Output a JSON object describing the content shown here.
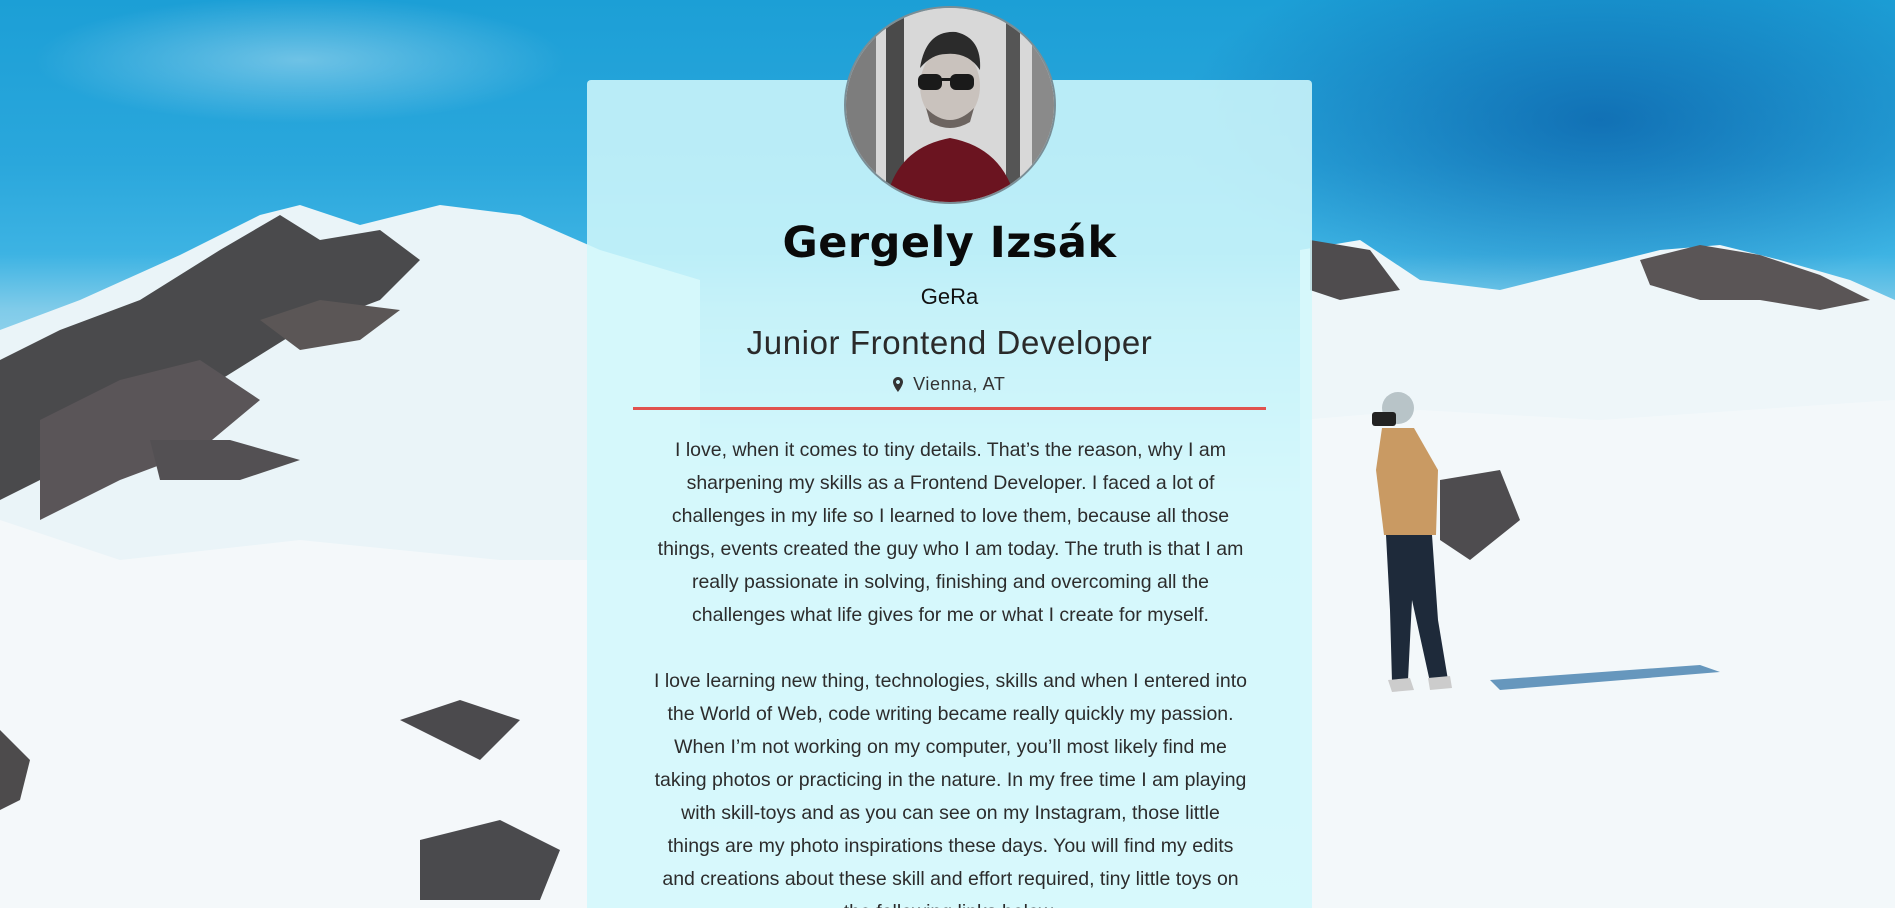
{
  "profile": {
    "name": "Gergely Izsák",
    "nickname": "GeRa",
    "role": "Junior Frontend Developer",
    "location": "Vienna, AT",
    "location_icon": "map-pin-icon",
    "avatar": "profile-photo",
    "bio": [
      "I love, when it comes to tiny details. That’s the reason, why I am sharpening my skills as a Frontend Developer. I faced a lot of challenges in my life so I learned to love them, because all those things, events created the guy who I am today. The truth is that I am really passionate in solving, finishing and overcoming all the challenges what life gives for me or what I create for myself.",
      "I love learning new thing, technologies, skills and when I entered into the World of Web, code writing became really quickly my passion. When I’m not working on my computer, you’ll most likely find me taking photos or practicing in the nature. In my free time I am playing with skill-toys and as you can see on my Instagram, those little things are my photo inspirations these days. You will find my edits and creations about these skill and effort required, tiny little toys on the following links below."
    ]
  },
  "colors": {
    "divider": "#e0524e",
    "card_background": "#d2f8fc",
    "sky": "#1c9fd6"
  }
}
